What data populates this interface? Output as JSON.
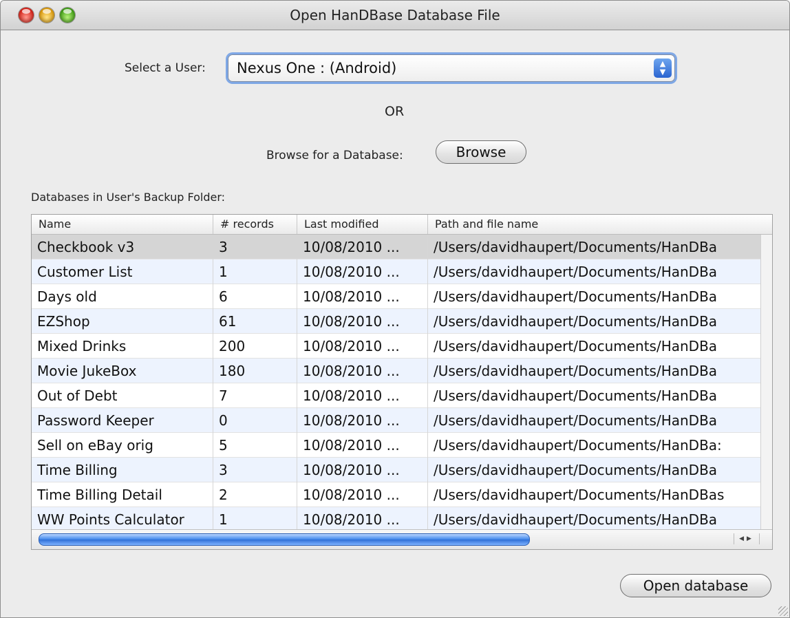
{
  "window": {
    "title": "Open HanDBase Database File"
  },
  "user_select": {
    "label": "Select a User:",
    "value": "Nexus One : (Android)"
  },
  "or_text": "OR",
  "browse": {
    "label": "Browse for a Database:",
    "button": "Browse"
  },
  "databases": {
    "label": "Databases in User's Backup Folder:",
    "columns": [
      "Name",
      "# records",
      "Last modified",
      "Path and file name"
    ],
    "rows": [
      {
        "name": "Checkbook v3",
        "records": "3",
        "modified": "10/08/2010 ...",
        "path": "/Users/davidhaupert/Documents/HanDBa"
      },
      {
        "name": "Customer List",
        "records": "1",
        "modified": "10/08/2010 ...",
        "path": "/Users/davidhaupert/Documents/HanDBa"
      },
      {
        "name": "Days old",
        "records": "6",
        "modified": "10/08/2010 ...",
        "path": "/Users/davidhaupert/Documents/HanDBa"
      },
      {
        "name": "EZShop",
        "records": "61",
        "modified": "10/08/2010 ...",
        "path": "/Users/davidhaupert/Documents/HanDBa"
      },
      {
        "name": "Mixed Drinks",
        "records": "200",
        "modified": "10/08/2010 ...",
        "path": "/Users/davidhaupert/Documents/HanDBa"
      },
      {
        "name": "Movie JukeBox",
        "records": "180",
        "modified": "10/08/2010 ...",
        "path": "/Users/davidhaupert/Documents/HanDBa"
      },
      {
        "name": "Out of Debt",
        "records": "7",
        "modified": "10/08/2010 ...",
        "path": "/Users/davidhaupert/Documents/HanDBa"
      },
      {
        "name": "Password Keeper",
        "records": "0",
        "modified": "10/08/2010 ...",
        "path": "/Users/davidhaupert/Documents/HanDBa"
      },
      {
        "name": "Sell on eBay orig",
        "records": "5",
        "modified": "10/08/2010 ...",
        "path": "/Users/davidhaupert/Documents/HanDBa:"
      },
      {
        "name": "Time Billing",
        "records": "3",
        "modified": "10/08/2010 ...",
        "path": "/Users/davidhaupert/Documents/HanDBa"
      },
      {
        "name": "Time Billing Detail",
        "records": "2",
        "modified": "10/08/2010 ...",
        "path": "/Users/davidhaupert/Documents/HanDBas"
      },
      {
        "name": "WW Points Calculator",
        "records": "1",
        "modified": "10/08/2010 ...",
        "path": "/Users/davidhaupert/Documents/HanDBa"
      }
    ],
    "selected_row": 0
  },
  "open_button": "Open database",
  "icons": {
    "close": "close-icon",
    "minimize": "minimize-icon",
    "zoom": "zoom-icon",
    "stepper": "updown-stepper-icon",
    "scroll_left": "scroll-left-icon",
    "scroll_right": "scroll-right-icon"
  },
  "colors": {
    "focus_ring": "#7fa8e6",
    "row_alt": "#edf3fe",
    "row_selected": "#d5d5d5",
    "scroll_thumb": "#3f86ea"
  }
}
